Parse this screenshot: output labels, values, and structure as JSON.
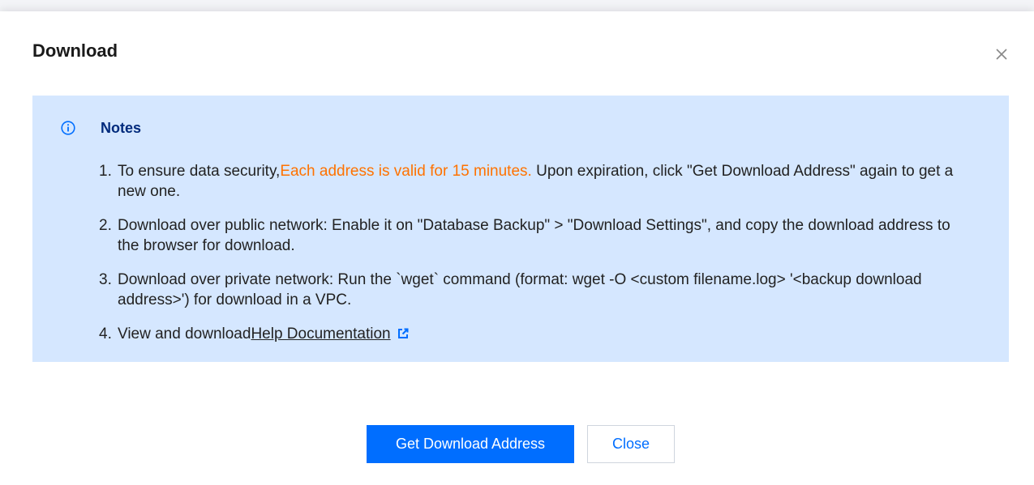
{
  "dialog": {
    "title": "Download",
    "close_icon": "close-icon"
  },
  "notes": {
    "icon": "info-icon",
    "title": "Notes",
    "items": [
      {
        "number": "1.",
        "line1_before": "To ensure data security,",
        "line1_highlight": "Each address is valid for 15 minutes.",
        "line1_after": " Upon expiration, click \"Get Download Address\" again to get a",
        "line2": "new one."
      },
      {
        "number": "2.",
        "line1": "Download over public network: Enable it on \"Database Backup\" > \"Download Settings\", and copy the download address to",
        "line2": "the browser for download."
      },
      {
        "number": "3.",
        "line1": "Download over private network: Run the `wget` command (format: wget -O <custom filename.log> '<backup download",
        "line2": "address>') for download in a VPC."
      },
      {
        "number": "4.",
        "text": "View and download",
        "link": "Help Documentation",
        "link_icon": "external-link-icon"
      }
    ]
  },
  "footer": {
    "primary_button": "Get Download Address",
    "secondary_button": "Close"
  },
  "colors": {
    "primary": "#006eff",
    "notes_background": "#d5e7ff",
    "notes_title": "#002a7c",
    "highlight": "#ff7200",
    "text": "#222222"
  }
}
